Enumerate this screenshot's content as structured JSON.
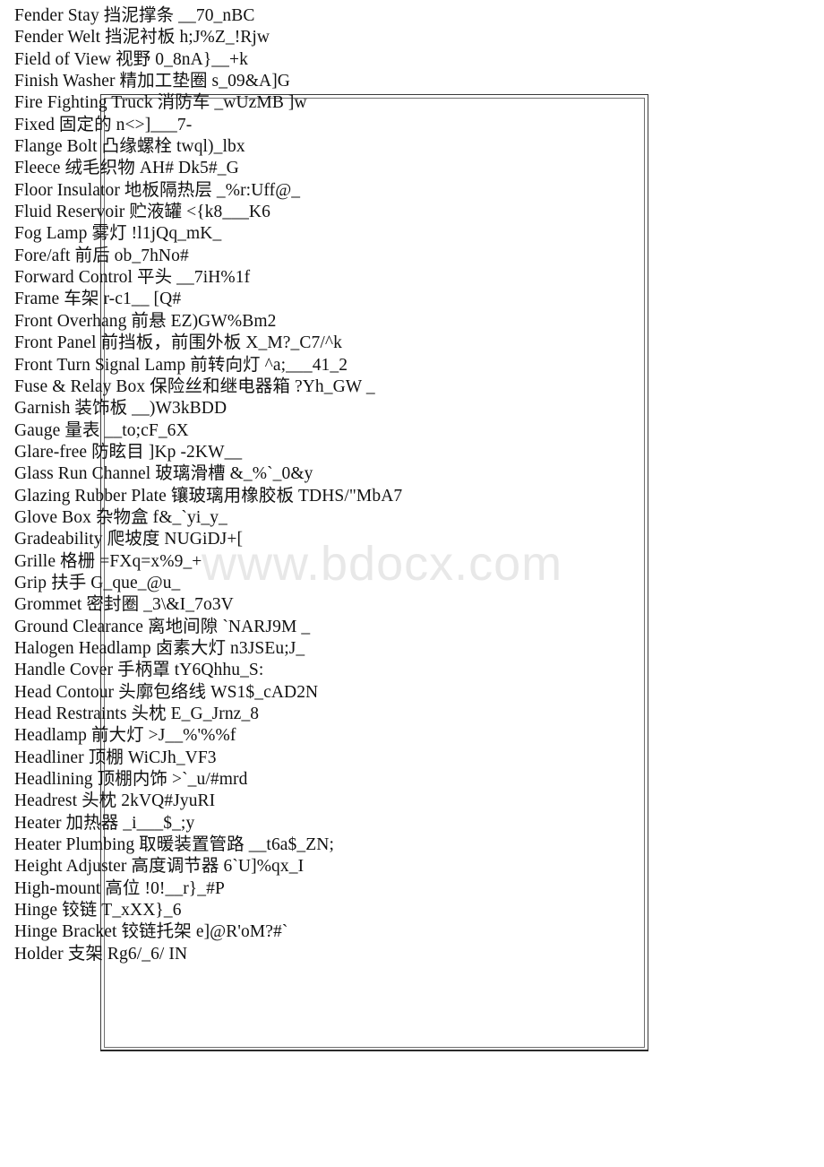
{
  "page": {
    "background_color": "#ffffff",
    "text_color": "#111111",
    "border_color": "#3a3a3a"
  },
  "watermark": {
    "text": "www.bdocx.com",
    "color": "#e8e8e8"
  },
  "glossary": {
    "entries": [
      "Fender Stay 挡泥撑条 __70_nBC",
      "Fender Welt 挡泥衬板 h;J%Z_!Rjw",
      "Field of View 视野 0_8nA}__+k",
      "Finish Washer 精加工垫圈 s_09&A]G",
      "Fire Fighting Truck 消防车 _wUzMB ]w",
      "Fixed 固定的 n<>]___7-",
      "Flange Bolt 凸缘螺栓 twql)_lbx",
      "Fleece 绒毛织物 AH# Dk5#_G",
      "Floor Insulator 地板隔热层 _%r:Uff@_",
      "Fluid Reservoir 贮液罐 <{k8___K6",
      "Fog Lamp 雾灯 !l1jQq_mK_",
      "Fore/aft 前后 ob_7hNo#",
      "Forward Control 平头 __7iH%1f",
      "Frame 车架 r-c1__ [Q#",
      "Front Overhang 前悬 EZ)GW%Bm2",
      "Front Panel 前挡板，前围外板 X_M?_C7/^k",
      "Front Turn Signal Lamp 前转向灯 ^a;___41_2",
      "Fuse & Relay Box 保险丝和继电器箱 ?Yh_GW _",
      "Garnish 装饰板 __)W3kBDD",
      "Gauge 量表 __to;cF_6X",
      "Glare-free 防眩目 ]Kp -2KW__",
      "Glass Run Channel 玻璃滑槽 &_%`_0&y",
      "Glazing Rubber Plate 镶玻璃用橡胶板 TDHS/\"MbA7",
      "Glove Box 杂物盒 f&_`yi_y_",
      "Gradeability 爬坡度 NUGiDJ+[",
      "Grille 格栅 =FXq=x%9_+",
      "Grip 扶手 G_que_@u_",
      "Grommet 密封圈 _3\\&I_7o3V",
      "Ground Clearance 离地间隙 `NARJ9M _",
      "Halogen Headlamp 卤素大灯 n3JSEu;J_",
      "Handle Cover 手柄罩 tY6Qhhu_S:",
      "Head Contour 头廓包络线 WS1$_cAD2N",
      "Head Restraints 头枕 E_G_Jrnz_8",
      "Headlamp 前大灯 >J__%'%%f",
      "Headliner 顶棚 WiCJh_VF3",
      "Headlining 顶棚内饰 >`_u/#mrd",
      "Headrest 头枕 2kVQ#JyuRI",
      "Heater 加热器 _i___$_;y",
      "Heater Plumbing 取暖装置管路 __t6a$_ZN;",
      "Height Adjuster 高度调节器 6`U]%qx_I",
      "High-mount 高位 !0!__r}_#P",
      "Hinge 铰链 T_xXX}_6",
      "Hinge Bracket 铰链托架 e]@R'oM?#`",
      "Holder 支架 Rg6/_6/ IN"
    ]
  }
}
